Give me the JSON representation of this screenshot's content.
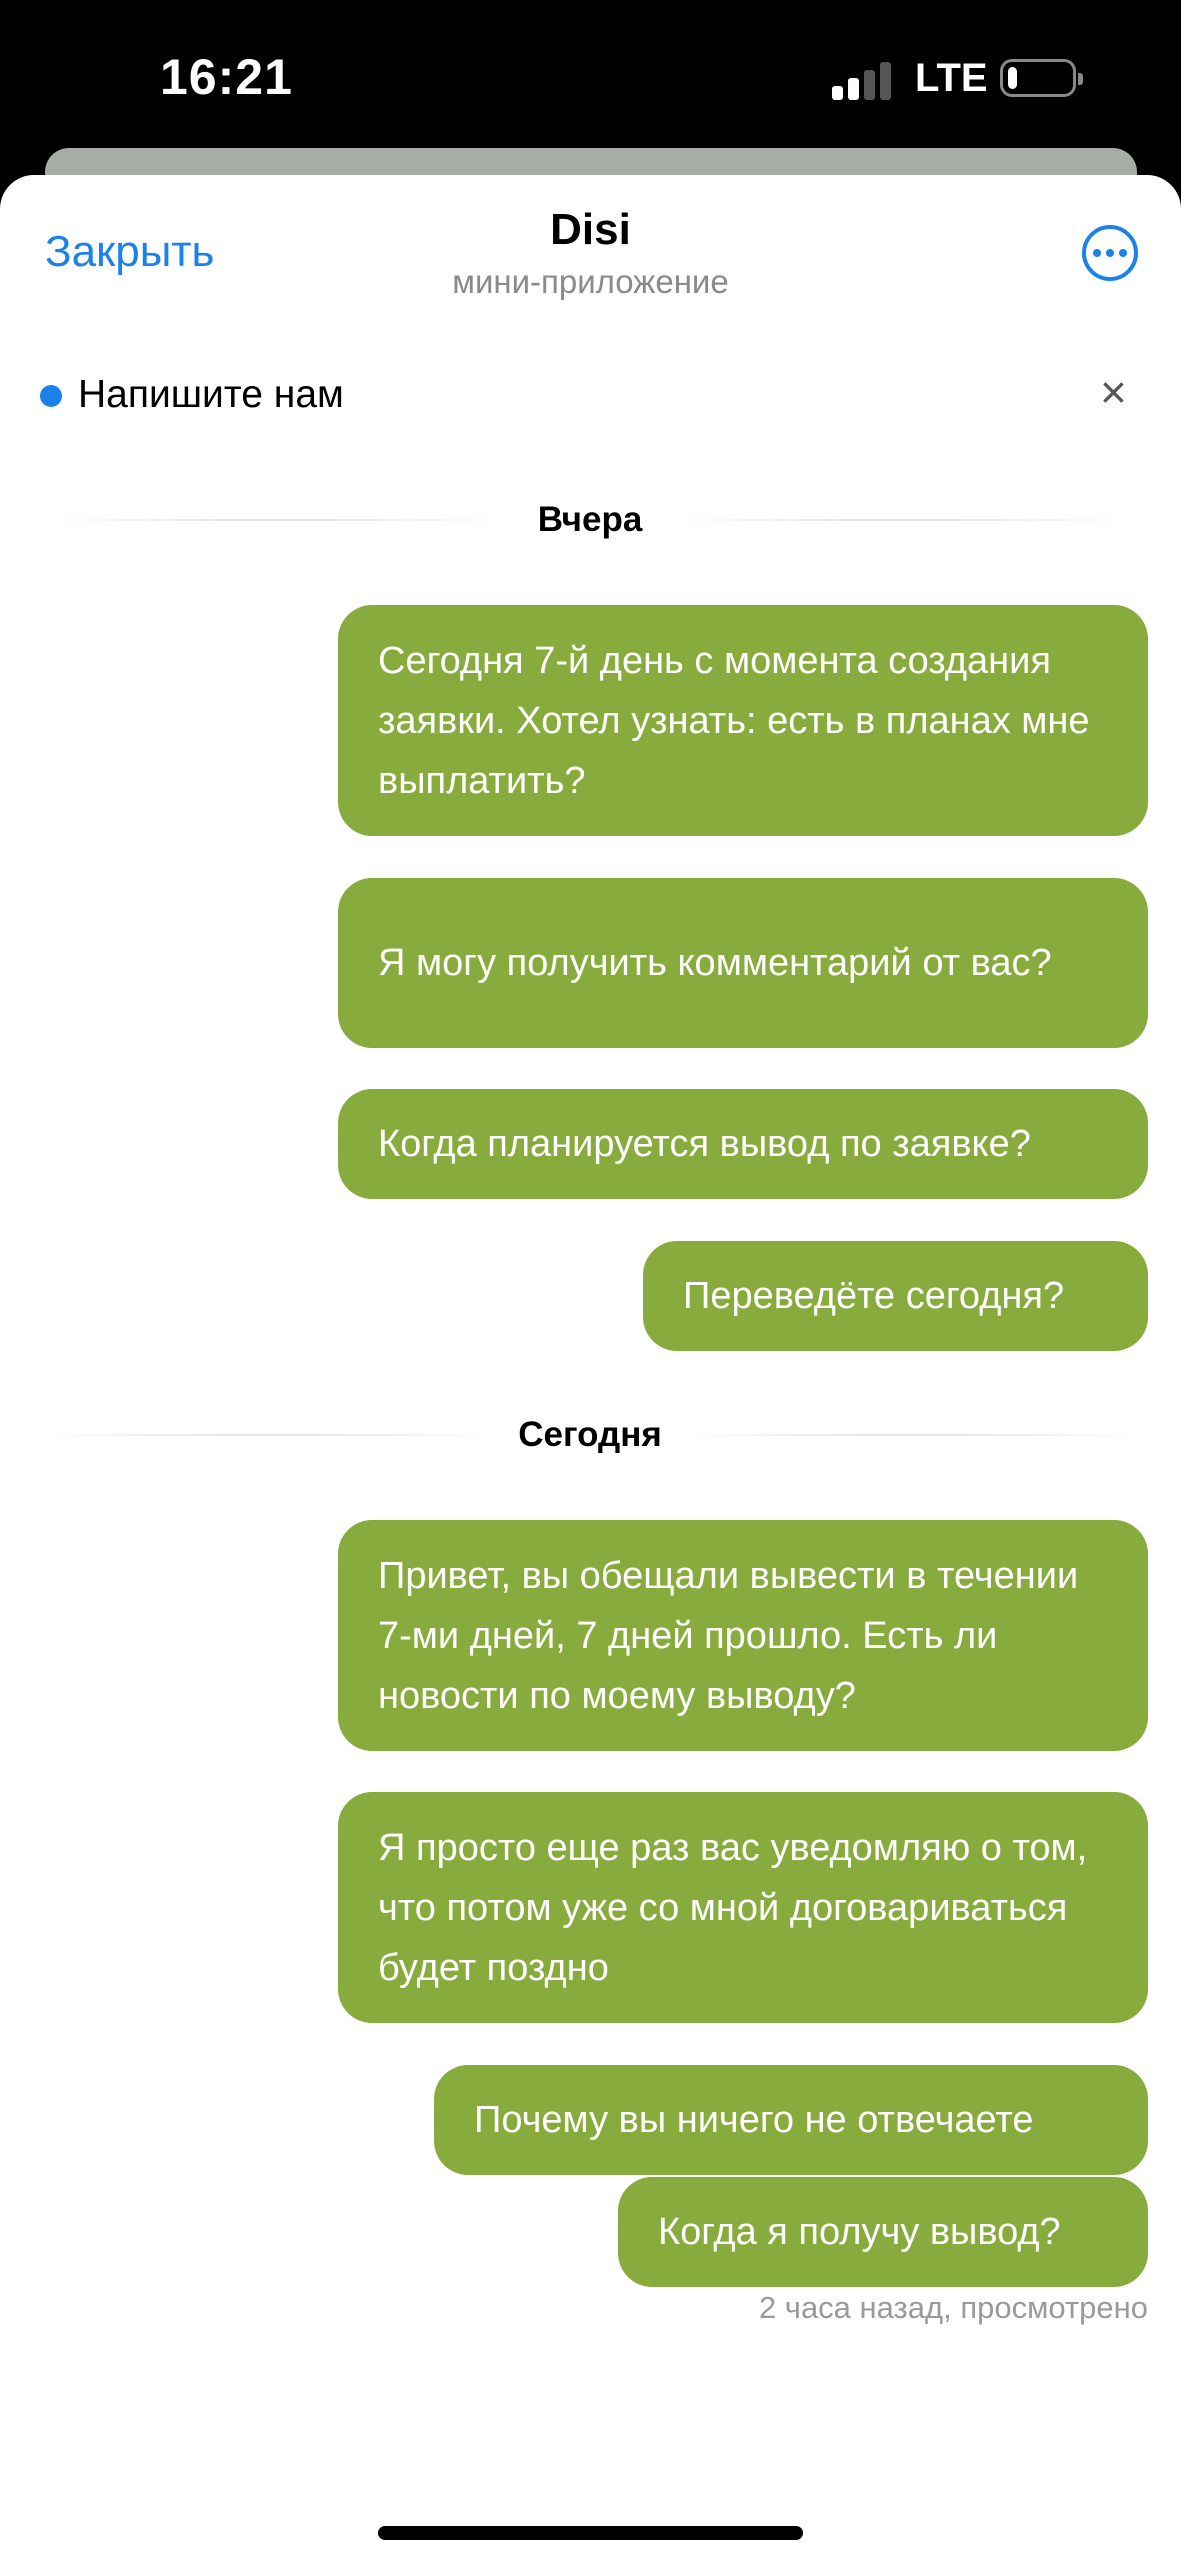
{
  "status_bar": {
    "time": "16:21",
    "network": "LTE",
    "battery_level": 0.15
  },
  "header": {
    "close_label": "Закрыть",
    "title": "Disi",
    "subtitle": "мини-приложение"
  },
  "banner": {
    "text": "Напишите нам",
    "close_glyph": "×"
  },
  "day_separators": [
    "Вчера",
    "Сегодня"
  ],
  "messages": [
    "Сегодня 7-й день  с момента создания заявки. Хотел узнать: есть в планах мне выплатить?",
    "Я могу получить комментарий от вас?",
    "Когда планируется вывод по заявке?",
    "Переведёте сегодня?",
    "Привет, вы обещали вывести в течении 7-ми дней, 7 дней прошло. Есть ли новости по моему выводу?",
    "Я просто еще раз вас уведомляю о том, что потом уже со мной договариваться будет поздно",
    "Почему вы ничего не отвечаете",
    "Когда я получу вывод?"
  ],
  "message_meta": "2 часа назад, просмотрено",
  "colors": {
    "accent": "#1a82e8",
    "bubble": "#88ab3d",
    "bubble_text": "#ffffff"
  }
}
